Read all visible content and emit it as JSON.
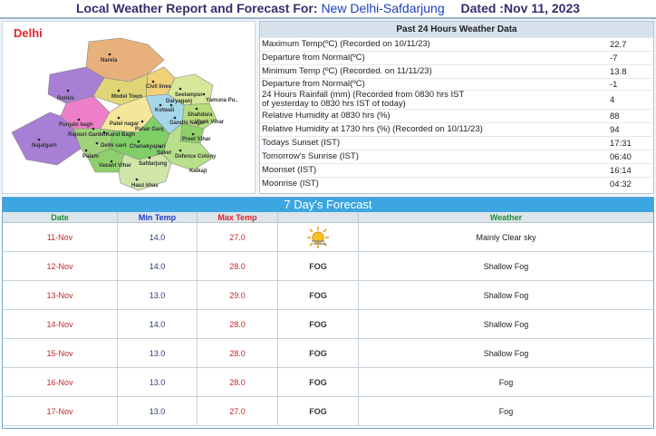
{
  "header": {
    "title_prefix": "Local Weather Report and Forecast For:",
    "station": "New Delhi-Safdarjung",
    "dated": "Dated :Nov 11, 2023"
  },
  "map": {
    "title": "Delhi",
    "labels": [
      "Narela",
      "Rohini",
      "Model Town",
      "Civil lines",
      "Seelampur",
      "Shahdara",
      "Preet Vihar",
      "Punjabi bagh",
      "Rajouri Garden",
      "Patel nagar",
      "Karol Bagh",
      "Delhi cant",
      "Najafgarh",
      "Palam",
      "Vasant Vihar",
      "Saket",
      "Defence Colony",
      "Kalkaji",
      "Hauz khas",
      "Safdarjung",
      "Chanakyapuri",
      "Kotwali",
      "Gandhi Nagar",
      "Vivek Vihar",
      "Yamuna Pu..",
      "Daryaganj",
      "Pahar Ganj"
    ]
  },
  "past24": {
    "title": "Past 24 Hours Weather Data",
    "rows": [
      {
        "label": "Maximum Temp(ºC) (Recorded on 10/11/23)",
        "value": "22.7"
      },
      {
        "label": "Departure from Normal(ºC)",
        "value": "-7"
      },
      {
        "label": "Minimum Temp (ºC) (Recorded. on 11/11/23)",
        "value": "13.8"
      },
      {
        "label": "Departure from Normal(ºC)",
        "value": "-1"
      },
      {
        "label": "24 Hours Rainfall (mm) (Recorded from 0830 hrs IST of yesterday to 0830 hrs IST of today)",
        "value": "4"
      },
      {
        "label": "Relative Humidity at 0830 hrs (%)",
        "value": "88"
      },
      {
        "label": "Relative Humidity at 1730 hrs (%) (Recorded on 10/11/23)",
        "value": "94"
      },
      {
        "label": "Todays Sunset (IST)",
        "value": "17:31"
      },
      {
        "label": "Tomorrow's Sunrise (IST)",
        "value": "06:40"
      },
      {
        "label": "Moonset (IST)",
        "value": "16:14"
      },
      {
        "label": "Moonrise (IST)",
        "value": "04:32"
      }
    ]
  },
  "forecast": {
    "title": "7 Day's Forecast",
    "columns": [
      "Date",
      "Min Temp",
      "Max Temp",
      "",
      "Weather"
    ],
    "column_colors": [
      "#1e8c3a",
      "#1f3fc4",
      "#d4272c",
      "#1e8c3a",
      "#1e8c3a"
    ],
    "rows": [
      {
        "date": "11-Nov",
        "min": "14.0",
        "max": "27.0",
        "icon": "sun-haze-icon",
        "icon_text": "",
        "weather": "Mainly Clear sky"
      },
      {
        "date": "12-Nov",
        "min": "14.0",
        "max": "28.0",
        "icon": "fog-icon",
        "icon_text": "FOG",
        "weather": "Shallow Fog"
      },
      {
        "date": "13-Nov",
        "min": "13.0",
        "max": "29.0",
        "icon": "fog-icon",
        "icon_text": "FOG",
        "weather": "Shallow Fog"
      },
      {
        "date": "14-Nov",
        "min": "14.0",
        "max": "28.0",
        "icon": "fog-icon",
        "icon_text": "FOG",
        "weather": "Shallow Fog"
      },
      {
        "date": "15-Nov",
        "min": "13.0",
        "max": "28.0",
        "icon": "fog-icon",
        "icon_text": "FOG",
        "weather": "Shallow Fog"
      },
      {
        "date": "16-Nov",
        "min": "13.0",
        "max": "28.0",
        "icon": "fog-icon",
        "icon_text": "FOG",
        "weather": "Fog"
      },
      {
        "date": "17-Nov",
        "min": "13.0",
        "max": "27.0",
        "icon": "fog-icon",
        "icon_text": "FOG",
        "weather": "Fog"
      }
    ]
  }
}
